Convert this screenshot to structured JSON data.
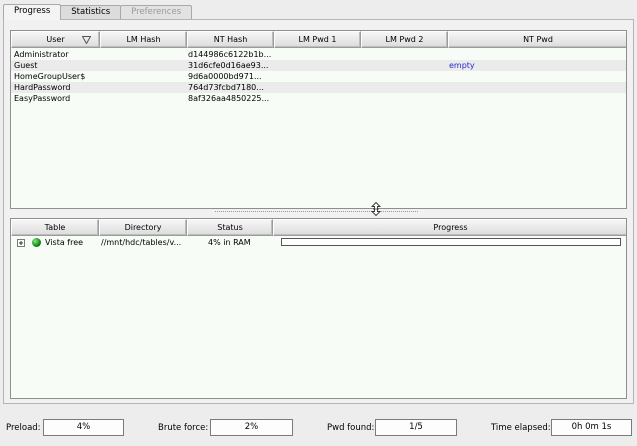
{
  "tabs": [
    {
      "label": "Progress",
      "active": true
    },
    {
      "label": "Statistics",
      "active": false
    },
    {
      "label": "Preferences",
      "active": false,
      "disabled": true
    }
  ],
  "users_table": {
    "columns": [
      "User",
      "LM Hash",
      "NT Hash",
      "LM Pwd 1",
      "LM Pwd 2",
      "NT Pwd"
    ],
    "rows": [
      {
        "user": "Administrator",
        "lm_hash": "",
        "nt_hash": "d144986c6122b1b...",
        "lm_pwd1": "",
        "lm_pwd2": "",
        "nt_pwd": ""
      },
      {
        "user": "Guest",
        "lm_hash": "",
        "nt_hash": "31d6cfe0d16ae93...",
        "lm_pwd1": "",
        "lm_pwd2": "",
        "nt_pwd": "empty"
      },
      {
        "user": "HomeGroupUser$",
        "lm_hash": "",
        "nt_hash": "9d6a0000bd971...",
        "lm_pwd1": "",
        "lm_pwd2": "",
        "nt_pwd": ""
      },
      {
        "user": "HardPassword",
        "lm_hash": "",
        "nt_hash": "764d73fcbd7180...",
        "lm_pwd1": "",
        "lm_pwd2": "",
        "nt_pwd": ""
      },
      {
        "user": "EasyPassword",
        "lm_hash": "",
        "nt_hash": "8af326aa4850225...",
        "lm_pwd1": "",
        "lm_pwd2": "",
        "nt_pwd": ""
      }
    ]
  },
  "tables_list": {
    "columns": [
      "Table",
      "Directory",
      "Status",
      "Progress"
    ],
    "rows": [
      {
        "table": "Vista free",
        "directory": "//mnt/hdc/tables/v...",
        "status": "4% in RAM",
        "progress_fraction": 0.0
      }
    ]
  },
  "statusbar": {
    "preload_label": "Preload:",
    "preload_value": "4%",
    "brute_label": "Brute force:",
    "brute_value": "2%",
    "found_label": "Pwd found:",
    "found_value": "1/5",
    "elapsed_label": "Time elapsed:",
    "elapsed_value": "0h 0m 1s"
  },
  "icons": {
    "sort": "sort-descending-icon",
    "splitter": "vertical-resize-icon",
    "tree": "tree-expand-icon",
    "status_dot": "status-ok-icon"
  },
  "colors": {
    "list_bg": "#f7fcf7",
    "link": "#2a2ad0",
    "status_ok": "#0a8a0a"
  }
}
